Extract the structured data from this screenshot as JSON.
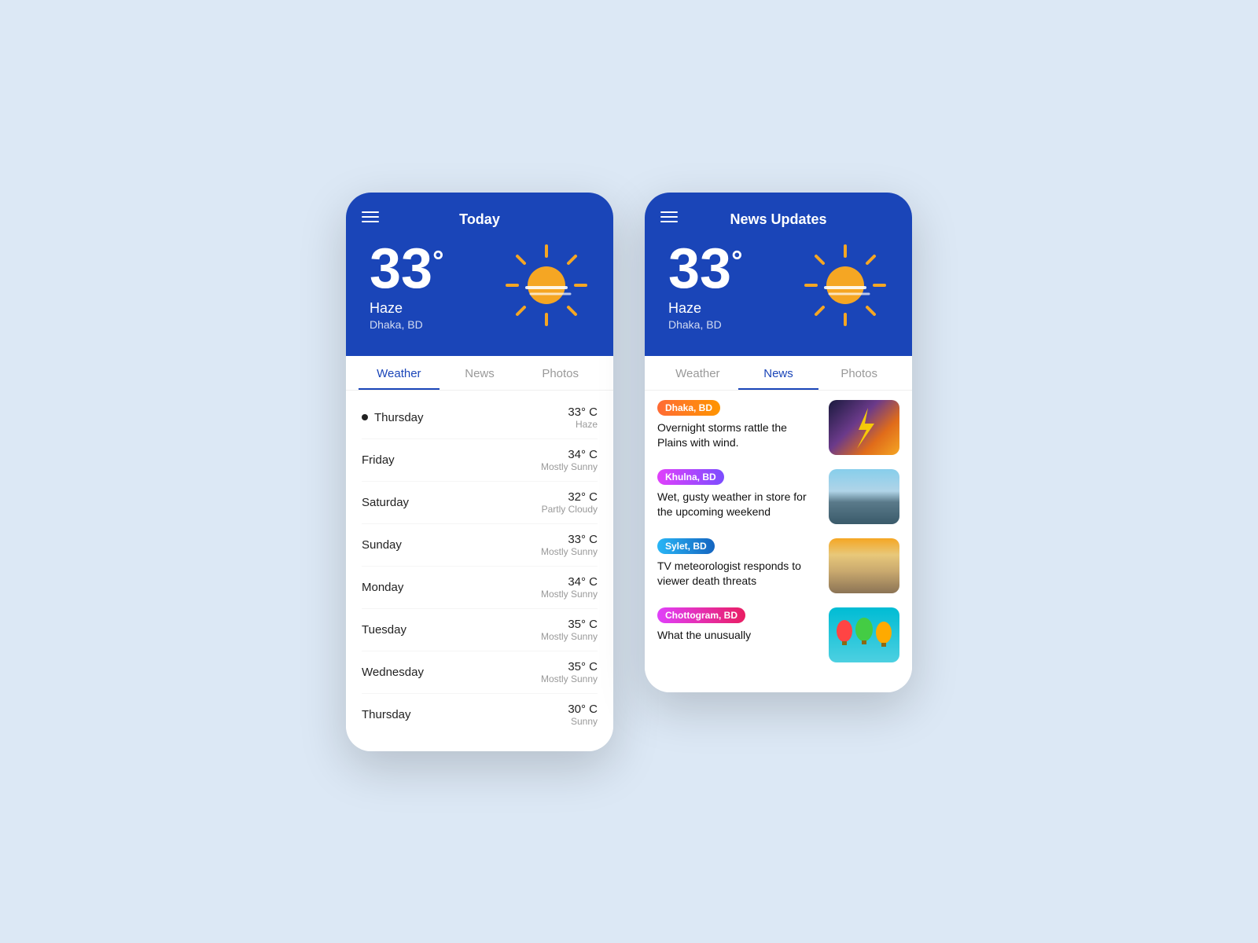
{
  "phone1": {
    "header": {
      "menu_icon": "menu",
      "title": "Today",
      "temp": "33",
      "degree": "°",
      "condition": "Haze",
      "location": "Dhaka, BD"
    },
    "tabs": [
      {
        "label": "Weather",
        "active": true
      },
      {
        "label": "News",
        "active": false
      },
      {
        "label": "Photos",
        "active": false
      }
    ],
    "forecast": [
      {
        "day": "Thursday",
        "dot": true,
        "temp": "33° C",
        "condition": "Haze"
      },
      {
        "day": "Friday",
        "dot": false,
        "temp": "34° C",
        "condition": "Mostly Sunny"
      },
      {
        "day": "Saturday",
        "dot": false,
        "temp": "32° C",
        "condition": "Partly Cloudy"
      },
      {
        "day": "Sunday",
        "dot": false,
        "temp": "33° C",
        "condition": "Mostly Sunny"
      },
      {
        "day": "Monday",
        "dot": false,
        "temp": "34° C",
        "condition": "Mostly Sunny"
      },
      {
        "day": "Tuesday",
        "dot": false,
        "temp": "35° C",
        "condition": "Mostly Sunny"
      },
      {
        "day": "Wednesday",
        "dot": false,
        "temp": "35° C",
        "condition": "Mostly Sunny"
      },
      {
        "day": "Thursday",
        "dot": false,
        "temp": "30° C",
        "condition": "Sunny"
      }
    ]
  },
  "phone2": {
    "header": {
      "menu_icon": "menu",
      "title": "News Updates",
      "temp": "33",
      "degree": "°",
      "condition": "Haze",
      "location": "Dhaka, BD"
    },
    "tabs": [
      {
        "label": "Weather",
        "active": false
      },
      {
        "label": "News",
        "active": true
      },
      {
        "label": "Photos",
        "active": false
      }
    ],
    "news": [
      {
        "badge": "Dhaka, BD",
        "badge_class": "badge-orange",
        "title": "Overnight storms rattle the Plains with wind.",
        "img_class": "img-storm"
      },
      {
        "badge": "Khulna, BD",
        "badge_class": "badge-pink",
        "title": "Wet, gusty weather in store for the upcoming weekend",
        "img_class": "img-mountain"
      },
      {
        "badge": "Sylet, BD",
        "badge_class": "badge-blue",
        "title": "TV meteorologist responds to viewer death threats",
        "img_class": "img-fog"
      },
      {
        "badge": "Chottogram, BD",
        "badge_class": "badge-chot",
        "title": "What the unusually",
        "img_class": "img-balloon"
      }
    ]
  }
}
